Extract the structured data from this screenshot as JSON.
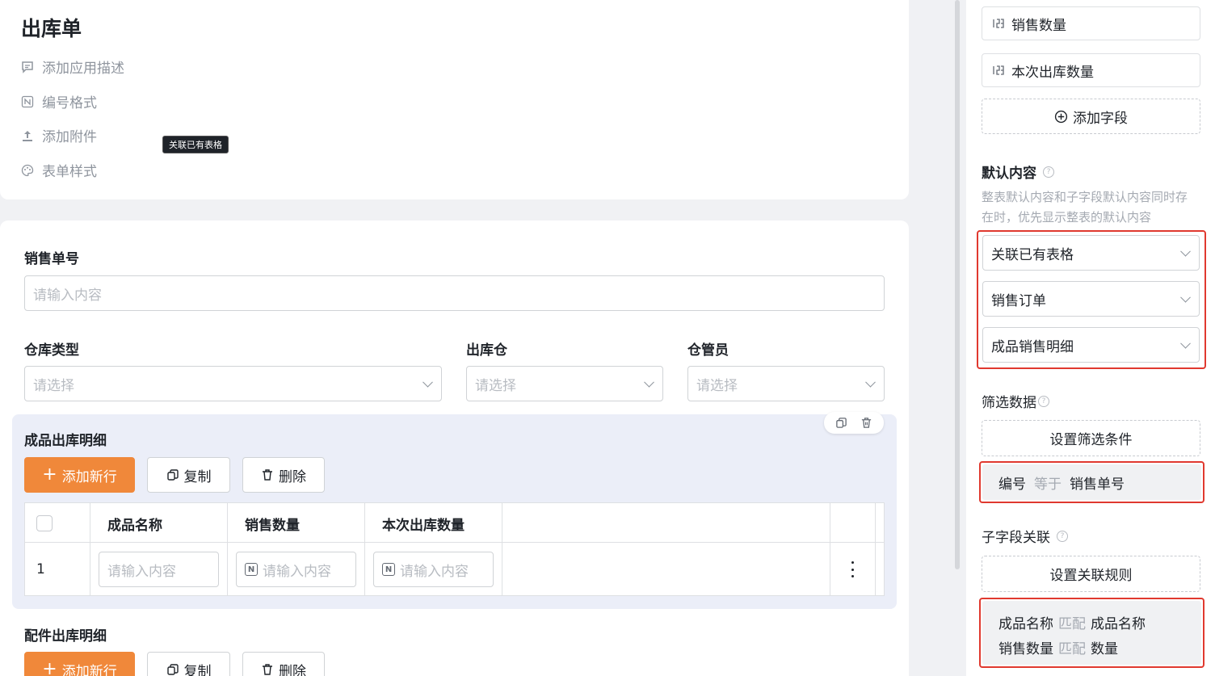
{
  "form": {
    "title": "出库单",
    "meta": {
      "add_description": "添加应用描述",
      "number_format": "编号格式",
      "add_attachment": "添加附件",
      "form_style": "表单样式"
    },
    "tooltip": "关联已有表格"
  },
  "fields": {
    "sales_no": {
      "label": "销售单号",
      "placeholder": "请输入内容"
    },
    "warehouse_type": {
      "label": "仓库类型",
      "placeholder": "请选择"
    },
    "out_warehouse": {
      "label": "出库仓",
      "placeholder": "请选择"
    },
    "keeper": {
      "label": "仓管员",
      "placeholder": "请选择"
    }
  },
  "subtable1": {
    "title": "成品出库明细",
    "add_row": "添加新行",
    "copy": "复制",
    "delete": "删除",
    "columns": [
      "成品名称",
      "销售数量",
      "本次出库数量"
    ],
    "rows": [
      {
        "index": "1",
        "cells": [
          "请输入内容",
          "请输入内容",
          "请输入内容"
        ]
      }
    ]
  },
  "subtable2": {
    "title": "配件出库明细",
    "add_row": "添加新行",
    "copy": "复制",
    "delete": "删除"
  },
  "right_panel": {
    "fields": [
      "销售数量",
      "本次出库数量"
    ],
    "add_field": "添加字段",
    "default_content": {
      "title": "默认内容",
      "hint": "整表默认内容和子字段默认内容同时存在时，优先显示整表的默认内容",
      "selects": [
        "关联已有表格",
        "销售订单",
        "成品销售明细"
      ]
    },
    "filter": {
      "title": "筛选数据",
      "button": "设置筛选条件",
      "condition": {
        "left": "编号",
        "op": "等于",
        "right": "销售单号"
      }
    },
    "sub_link": {
      "title": "子字段关联",
      "button": "设置关联规则",
      "rules": [
        {
          "left": "成品名称",
          "op": "匹配",
          "right": "成品名称"
        },
        {
          "left": "销售数量",
          "op": "匹配",
          "right": "数量"
        }
      ]
    }
  },
  "colors": {
    "accent": "#f0883a",
    "highlight": "#e0392f"
  }
}
